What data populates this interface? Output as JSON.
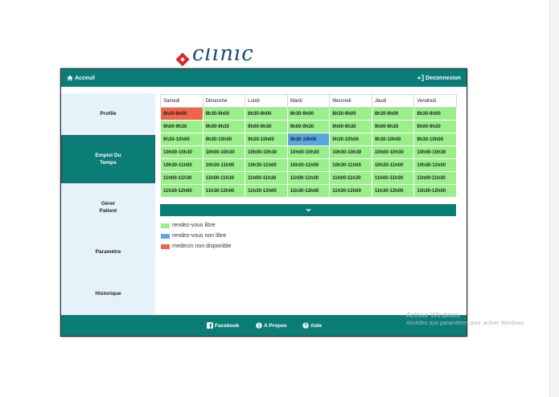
{
  "topbar": {
    "home_label": "Acceuil",
    "logout_label": "Deconnexion"
  },
  "sidebar": {
    "items": [
      {
        "label": "Profile"
      },
      {
        "label": "Emploi Du\nTemps"
      },
      {
        "label": "Gérer\nPatient"
      },
      {
        "label": "Paramètre"
      },
      {
        "label": "Historique"
      }
    ]
  },
  "schedule": {
    "days": [
      "Samedi",
      "Dimanche",
      "Lundi",
      "Mardi",
      "Mercredi",
      "Jeudi",
      "Vendredi"
    ],
    "rows": [
      [
        "8h30-9h00",
        "8h30-9h00",
        "8h30-9h00",
        "8h30-9h00",
        "8h30-9h00",
        "8h30-9h00",
        "8h30-9h00"
      ],
      [
        "9h00-9h30",
        "9h00-9h30",
        "9h00-9h30",
        "9h00-9h30",
        "9h00-9h30",
        "9h00-9h30",
        "9h00-9h30"
      ],
      [
        "9h30-10h00",
        "9h30-10h00",
        "9h30-10h00",
        "9h30-10h00",
        "9h30-10h00",
        "9h30-10h00",
        "9h30-10h00"
      ],
      [
        "10h00-10h30",
        "10h00-10h30",
        "10h00-10h30",
        "10h00-10h30",
        "10h00-10h30",
        "10h00-10h30",
        "10h00-10h30"
      ],
      [
        "10h30-11h00",
        "10h30-11h00",
        "10h30-11h00",
        "10h30-11h00",
        "10h30-11h00",
        "10h30-11h00",
        "10h30-11h00"
      ],
      [
        "11h00-11h30",
        "11h00-11h30",
        "11h00-11h30",
        "11h00-11h30",
        "11h00-11h30",
        "11h00-11h30",
        "11h00-11h30"
      ],
      [
        "11h30-12h00",
        "11h30-12h00",
        "11h30-12h00",
        "11h30-12h00",
        "11h30-12h00",
        "11h30-12h00",
        "11h30-12h00"
      ]
    ],
    "cell_status": [
      [
        "unavailable",
        "free",
        "free",
        "free",
        "free",
        "free",
        "free"
      ],
      [
        "free",
        "free",
        "free",
        "free",
        "free",
        "free",
        "free"
      ],
      [
        "free",
        "free",
        "free",
        "taken",
        "free",
        "free",
        "free"
      ],
      [
        "free",
        "free",
        "free",
        "free",
        "free",
        "free",
        "free"
      ],
      [
        "free",
        "free",
        "free",
        "free",
        "free",
        "free",
        "free"
      ],
      [
        "free",
        "free",
        "free",
        "free",
        "free",
        "free",
        "free"
      ],
      [
        "free",
        "free",
        "free",
        "free",
        "free",
        "free",
        "free"
      ]
    ]
  },
  "legend": [
    {
      "label": "rendez-vous libre",
      "color": "#99ef8a"
    },
    {
      "label": "rendez-vous non libre",
      "color": "#5aa6df"
    },
    {
      "label": "medecin non disponible",
      "color": "#ef6548"
    }
  ],
  "footer": {
    "facebook_label": "Facebook",
    "about_label": "A Propos",
    "help_label": "Aide"
  },
  "watermark": {
    "title": "Activer Windows",
    "subtitle": "Accédez aux paramètres pour activer Windows."
  },
  "colors": {
    "accent": "#0a7d77",
    "sidebar_bg": "#e6f2fa",
    "free": "#99ef8a",
    "taken": "#5aa6df",
    "unavailable": "#ef6548"
  }
}
